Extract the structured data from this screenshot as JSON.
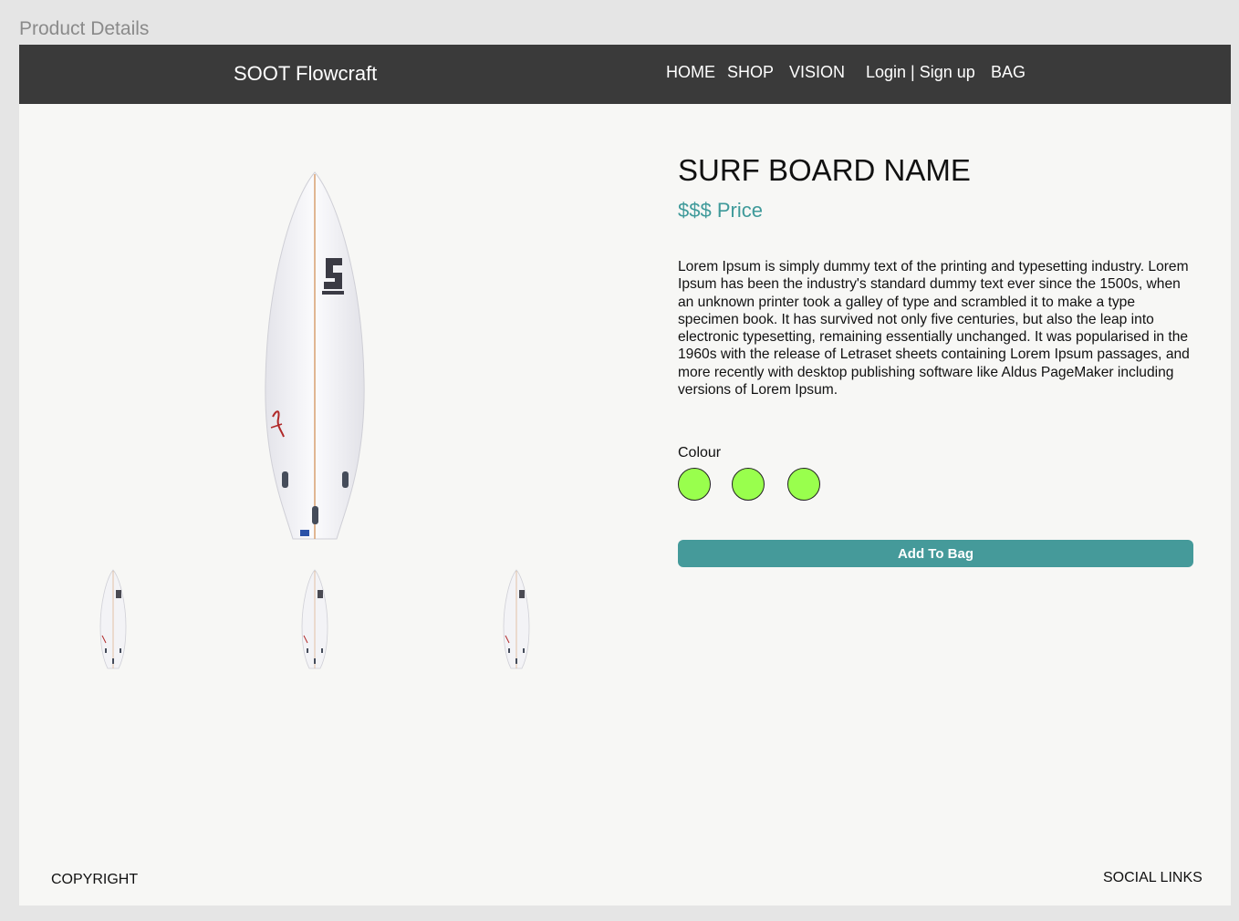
{
  "canvas": {
    "label": "Product Details"
  },
  "navbar": {
    "brand": "SOOT Flowcraft",
    "links": [
      {
        "label": "HOME"
      },
      {
        "label": "SHOP"
      },
      {
        "label": "VISION"
      },
      {
        "label": "Login | Sign up"
      },
      {
        "label": "BAG"
      }
    ]
  },
  "product": {
    "title": "SURF BOARD NAME",
    "price": "$$$ Price",
    "description": "Lorem Ipsum is simply dummy text of the printing and typesetting industry. Lorem Ipsum has been the industry's standard dummy text ever since the 1500s, when an unknown printer took a galley of type and scrambled it to make a type specimen book. It has survived not only five centuries, but also the leap into electronic typesetting, remaining essentially unchanged. It was popularised in the 1960s with the release of Letraset sheets containing Lorem Ipsum passages, and more recently with desktop publishing software like Aldus PageMaker including versions of Lorem Ipsum.",
    "colour_label": "Colour",
    "colours": [
      "#99ff4d",
      "#99ff4d",
      "#99ff4d"
    ],
    "add_to_bag": "Add To Bag",
    "thumbnail_count": 3
  },
  "footer": {
    "copyright": "COPYRIGHT",
    "social": "SOCIAL LINKS"
  },
  "theme": {
    "nav_bg": "#3a3a3a",
    "accent": "#459a9a",
    "price_color": "#3f9a9a",
    "page_bg": "#f7f7f5"
  }
}
